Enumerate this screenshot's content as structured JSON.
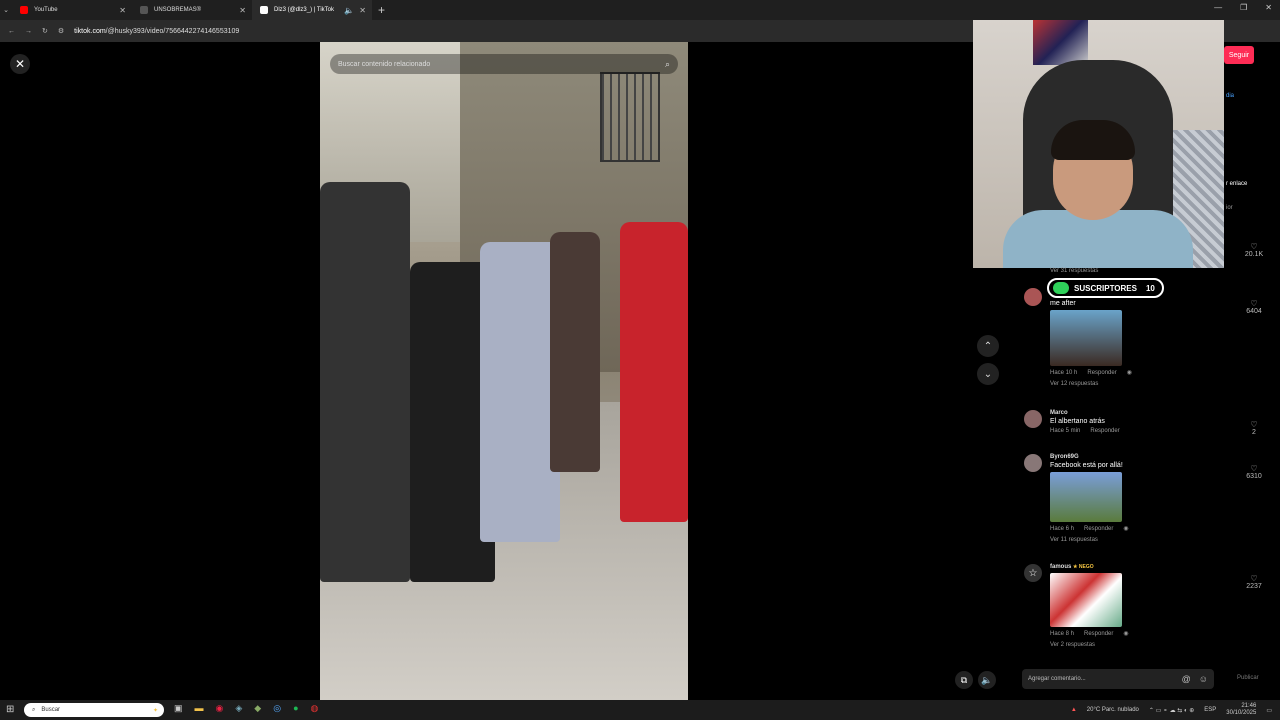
{
  "browser": {
    "tabs": [
      {
        "label": "YouTube",
        "color": "#ff0000"
      },
      {
        "label": "UNSOBREMAS®",
        "color": "#aaaaaa"
      },
      {
        "label": "Dlz3 (@dlz3_) | TikTok",
        "color": "#ffffff",
        "active": true
      }
    ],
    "new_tab": "+",
    "url_host": "tiktok.com",
    "url_path": "/@husky393/video/7566442274146553109"
  },
  "video": {
    "search_placeholder": "Buscar contenido relacionado"
  },
  "overlay": {
    "subscribers_label": "SUSCRIPTORES",
    "subscribers_count": "10"
  },
  "sidebar": {
    "follow_label": "Seguir",
    "side_text_1": "dia",
    "side_text_2": "r enlace",
    "side_text_3": "ior"
  },
  "comments": [
    {
      "replies_top": "Ver 31 respuestas",
      "text": "me after",
      "time": "Hace 10 h",
      "reply": "Responder",
      "replies": "Ver 12 respuestas",
      "likes": "6404"
    },
    {
      "user": "Marco",
      "text": "El albertano atrás",
      "time": "Hace 5 min",
      "reply": "Responder",
      "likes": "2"
    },
    {
      "user": "Byron69G",
      "text": "Facebook está por allá!",
      "time": "Hace 6 h",
      "reply": "Responder",
      "replies": "Ver 11 respuestas",
      "likes": "6310"
    },
    {
      "user": "famous",
      "badge": "★ NEGO",
      "time": "Hace 8 h",
      "reply": "Responder",
      "replies": "Ver 2 respuestas",
      "likes": "2237"
    }
  ],
  "top_likes": "20.1K",
  "comment_input": {
    "placeholder": "Agregar comentario...",
    "publish_label": "Publicar"
  },
  "taskbar": {
    "search_label": "Buscar",
    "weather": "20°C Parc. nublado",
    "lang": "ESP",
    "time": "21:46",
    "date": "30/10/2025"
  }
}
